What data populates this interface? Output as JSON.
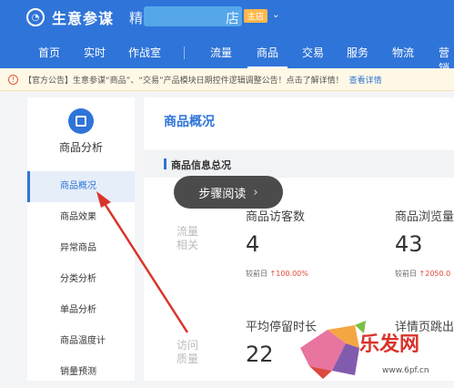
{
  "brand": {
    "name": "生意参谋",
    "store_fragment": "精",
    "store_fragment2": "店",
    "badge": "主店"
  },
  "nav": {
    "items": [
      "首页",
      "实时",
      "作战室",
      "流量",
      "商品",
      "交易",
      "服务",
      "物流",
      "营销"
    ],
    "active": "商品"
  },
  "notice": {
    "text": "【官方公告】生意参谋“商品”、“交易”产品模块日期控件逻辑调整公告！点击了解详情！",
    "link": "查看详情"
  },
  "sidebar": {
    "title": "商品分析",
    "items": [
      "商品概况",
      "商品效果",
      "异常商品",
      "分类分析",
      "单品分析",
      "商品温度计",
      "销量预测"
    ],
    "active": "商品概况"
  },
  "main": {
    "title": "商品概况",
    "section": "商品信息总况",
    "groups": [
      {
        "label": "流量相关",
        "metrics": [
          {
            "label": "商品访客数",
            "value": "4",
            "compare_label": "较前日",
            "compare_value": "↑100.00%"
          },
          {
            "label": "商品浏览量",
            "value": "43",
            "compare_label": "较前日",
            "compare_value": "↑2050.0"
          }
        ]
      },
      {
        "label": "访问质量",
        "metrics": [
          {
            "label": "平均停留时长",
            "value": "22"
          },
          {
            "label": "详情页跳出"
          }
        ]
      }
    ]
  },
  "tooltip": {
    "label": "步骤阅读",
    "chevron": "›"
  },
  "watermark": {
    "text": "乐发网",
    "url": "www.6pf.cn"
  },
  "colors": {
    "primary": "#2f74d8",
    "arrow": "#d9342b",
    "up": "#e5483b"
  }
}
